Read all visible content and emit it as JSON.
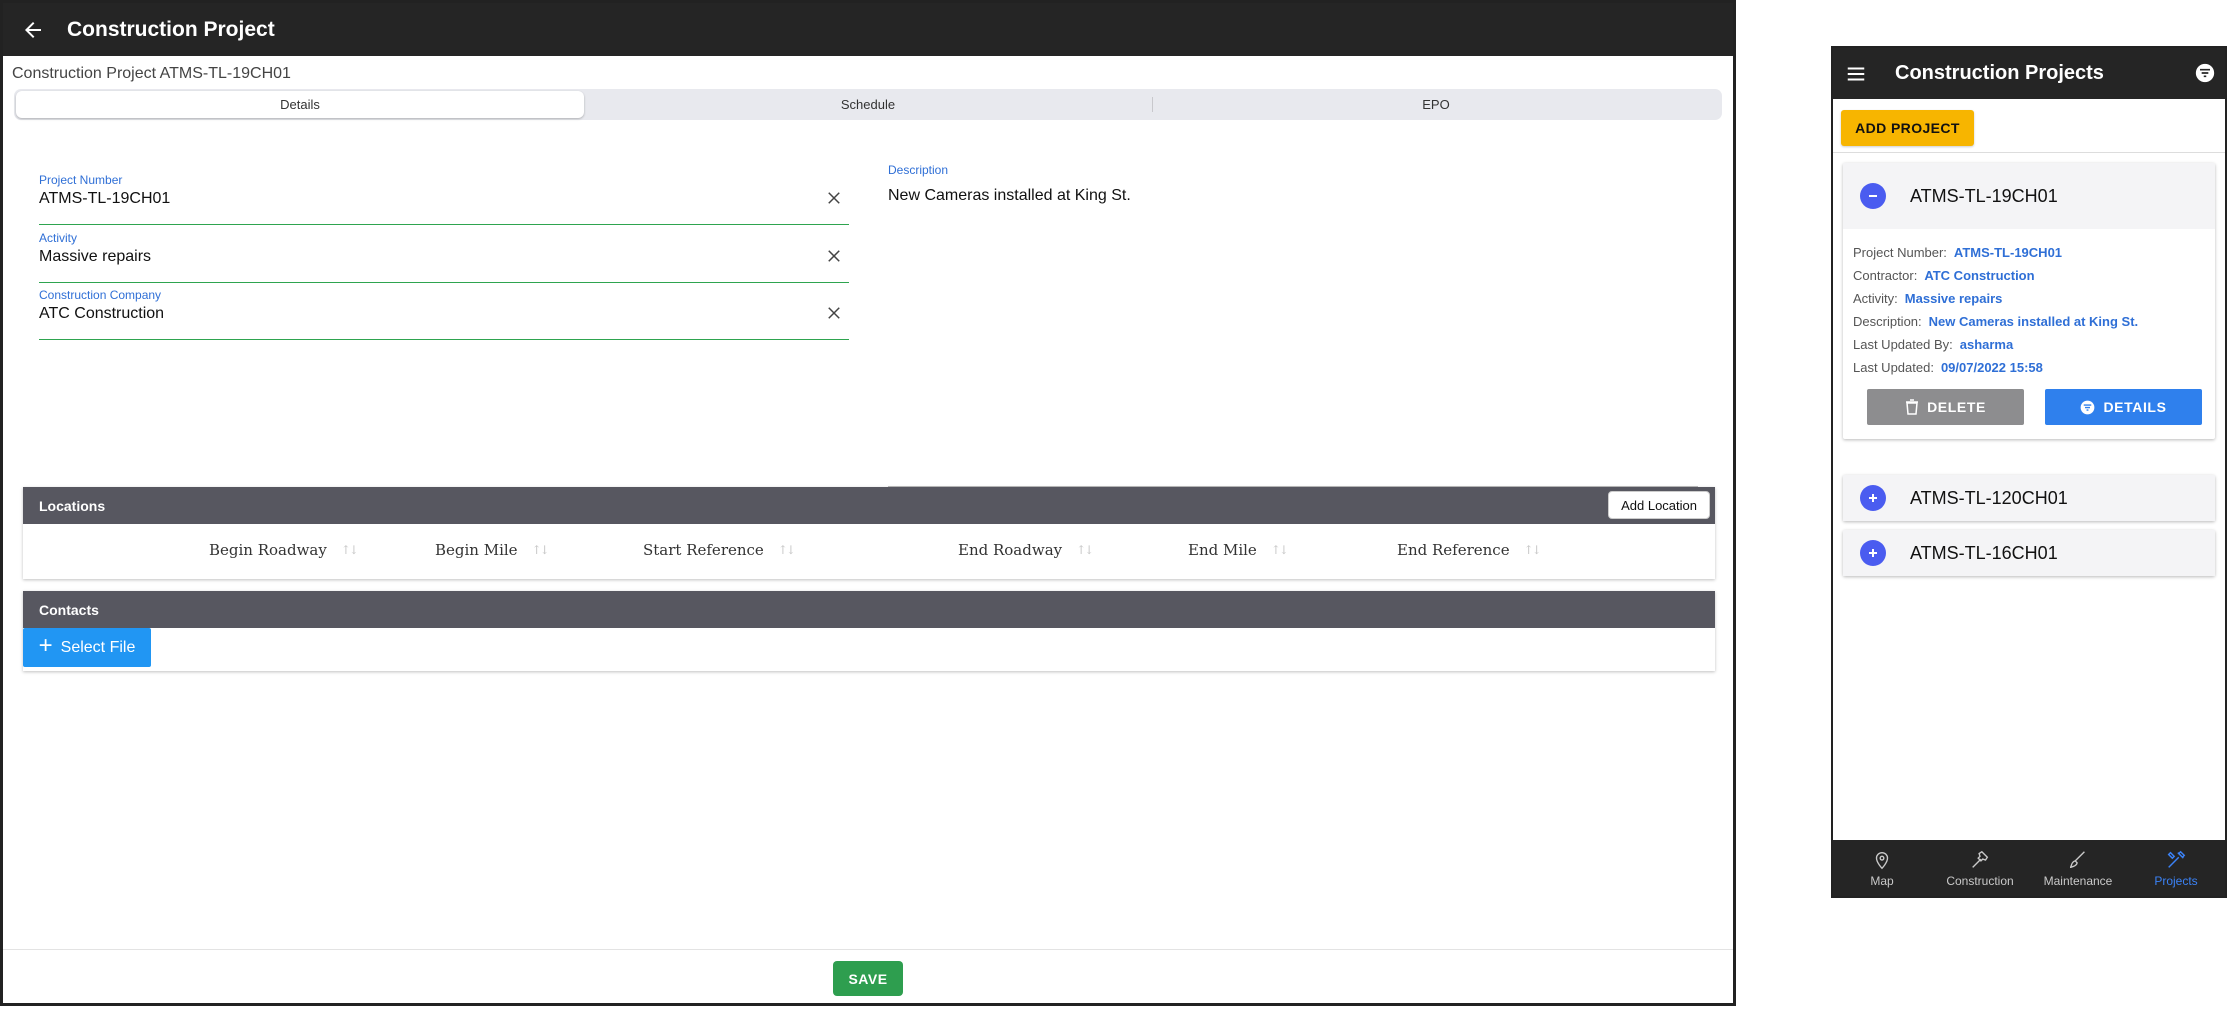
{
  "desktop": {
    "header_title": "Construction Project",
    "subtitle": "Construction Project ATMS-TL-19CH01",
    "tabs": [
      {
        "label": "Details",
        "active": true
      },
      {
        "label": "Schedule",
        "active": false
      },
      {
        "label": "EPO",
        "active": false
      }
    ],
    "fields": {
      "project_number": {
        "label": "Project Number",
        "value": "ATMS-TL-19CH01"
      },
      "activity": {
        "label": "Activity",
        "value": "Massive repairs"
      },
      "construction_company": {
        "label": "Construction Company",
        "value": "ATC Construction"
      },
      "description": {
        "label": "Description",
        "value": "New Cameras installed at King St."
      }
    },
    "locations": {
      "title": "Locations",
      "add_button": "Add Location",
      "columns": [
        "Begin Roadway",
        "Begin Mile",
        "Start Reference",
        "End Roadway",
        "End Mile",
        "End Reference"
      ]
    },
    "contacts": {
      "title": "Contacts",
      "select_file": "Select File"
    },
    "save_label": "SAVE"
  },
  "mobile": {
    "header_title": "Construction Projects",
    "add_button": "ADD PROJECT",
    "projects": [
      {
        "name": "ATMS-TL-19CH01",
        "expanded": true,
        "details": [
          {
            "label": "Project Number:",
            "value": "ATMS-TL-19CH01"
          },
          {
            "label": "Contractor:",
            "value": "ATC Construction"
          },
          {
            "label": "Activity:",
            "value": "Massive repairs"
          },
          {
            "label": "Description:",
            "value": "New Cameras installed at King St."
          },
          {
            "label": "Last Updated By:",
            "value": "asharma"
          },
          {
            "label": "Last Updated:",
            "value": "09/07/2022 15:58"
          }
        ],
        "delete_label": "DELETE",
        "details_label": "DETAILS"
      },
      {
        "name": "ATMS-TL-120CH01",
        "expanded": false
      },
      {
        "name": "ATMS-TL-16CH01",
        "expanded": false
      }
    ],
    "nav": [
      {
        "label": "Map",
        "icon": "map-pin-icon",
        "active": false
      },
      {
        "label": "Construction",
        "icon": "hammer-icon",
        "active": false
      },
      {
        "label": "Maintenance",
        "icon": "brush-icon",
        "active": false
      },
      {
        "label": "Projects",
        "icon": "tools-icon",
        "active": true
      }
    ],
    "accent_color": "#3b82f6"
  }
}
